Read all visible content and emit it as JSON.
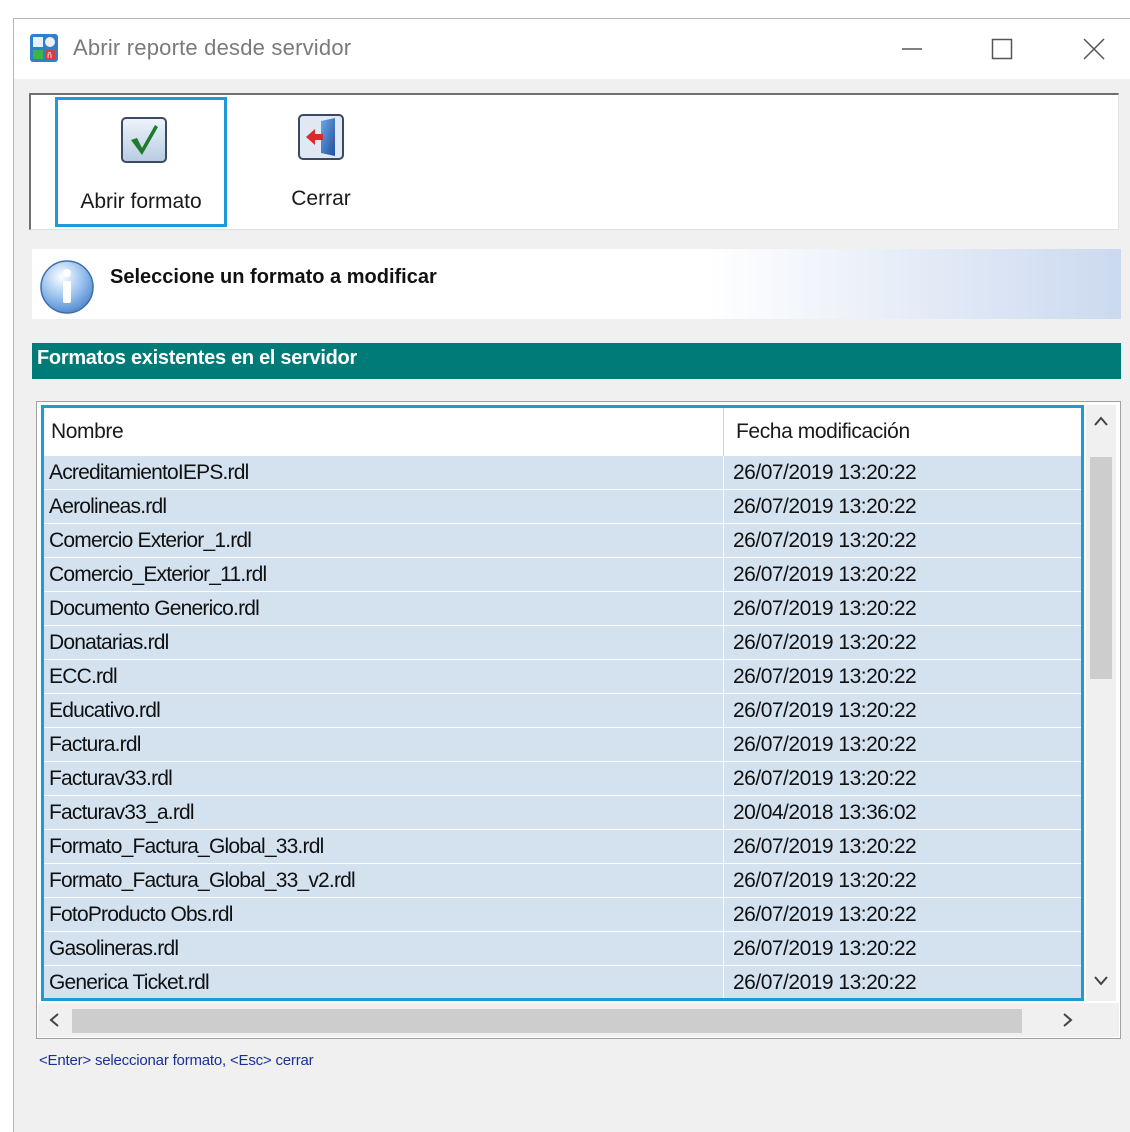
{
  "window": {
    "title": "Abrir reporte desde servidor",
    "icons": {
      "app": "report-app-icon",
      "minimize": "minimize-icon",
      "maximize": "maximize-icon",
      "close": "close-icon"
    }
  },
  "toolbar": {
    "open_label": "Abrir formato",
    "open_icon": "checkmark-icon",
    "close_label": "Cerrar",
    "close_icon": "exit-door-icon"
  },
  "info": {
    "icon": "info-icon",
    "text": "Seleccione un formato a modificar"
  },
  "section": {
    "title": "Formatos existentes en el servidor"
  },
  "list": {
    "columns": [
      "Nombre",
      "Fecha modificación"
    ],
    "rows": [
      {
        "name": "AcreditamientoIEPS.rdl",
        "date": "26/07/2019 13:20:22"
      },
      {
        "name": "Aerolineas.rdl",
        "date": "26/07/2019 13:20:22"
      },
      {
        "name": "Comercio Exterior_1.rdl",
        "date": "26/07/2019 13:20:22"
      },
      {
        "name": "Comercio_Exterior_11.rdl",
        "date": "26/07/2019 13:20:22"
      },
      {
        "name": "Documento Generico.rdl",
        "date": "26/07/2019 13:20:22"
      },
      {
        "name": "Donatarias.rdl",
        "date": "26/07/2019 13:20:22"
      },
      {
        "name": "ECC.rdl",
        "date": "26/07/2019 13:20:22"
      },
      {
        "name": "Educativo.rdl",
        "date": "26/07/2019 13:20:22"
      },
      {
        "name": "Factura.rdl",
        "date": "26/07/2019 13:20:22"
      },
      {
        "name": "Facturav33.rdl",
        "date": "26/07/2019 13:20:22"
      },
      {
        "name": "Facturav33_a.rdl",
        "date": "20/04/2018 13:36:02"
      },
      {
        "name": "Formato_Factura_Global_33.rdl",
        "date": "26/07/2019 13:20:22"
      },
      {
        "name": "Formato_Factura_Global_33_v2.rdl",
        "date": "26/07/2019 13:20:22"
      },
      {
        "name": "FotoProducto Obs.rdl",
        "date": "26/07/2019 13:20:22"
      },
      {
        "name": "Gasolineras.rdl",
        "date": "26/07/2019 13:20:22"
      },
      {
        "name": "Generica Ticket.rdl",
        "date": "26/07/2019 13:20:22"
      }
    ]
  },
  "hint": {
    "text": "<Enter> seleccionar formato, <Esc> cerrar"
  },
  "colors": {
    "accent_border": "#1e9bd7",
    "section_bg": "#007b77",
    "row_bg": "#d4e2f0",
    "hint_text": "#1a2f9c"
  }
}
